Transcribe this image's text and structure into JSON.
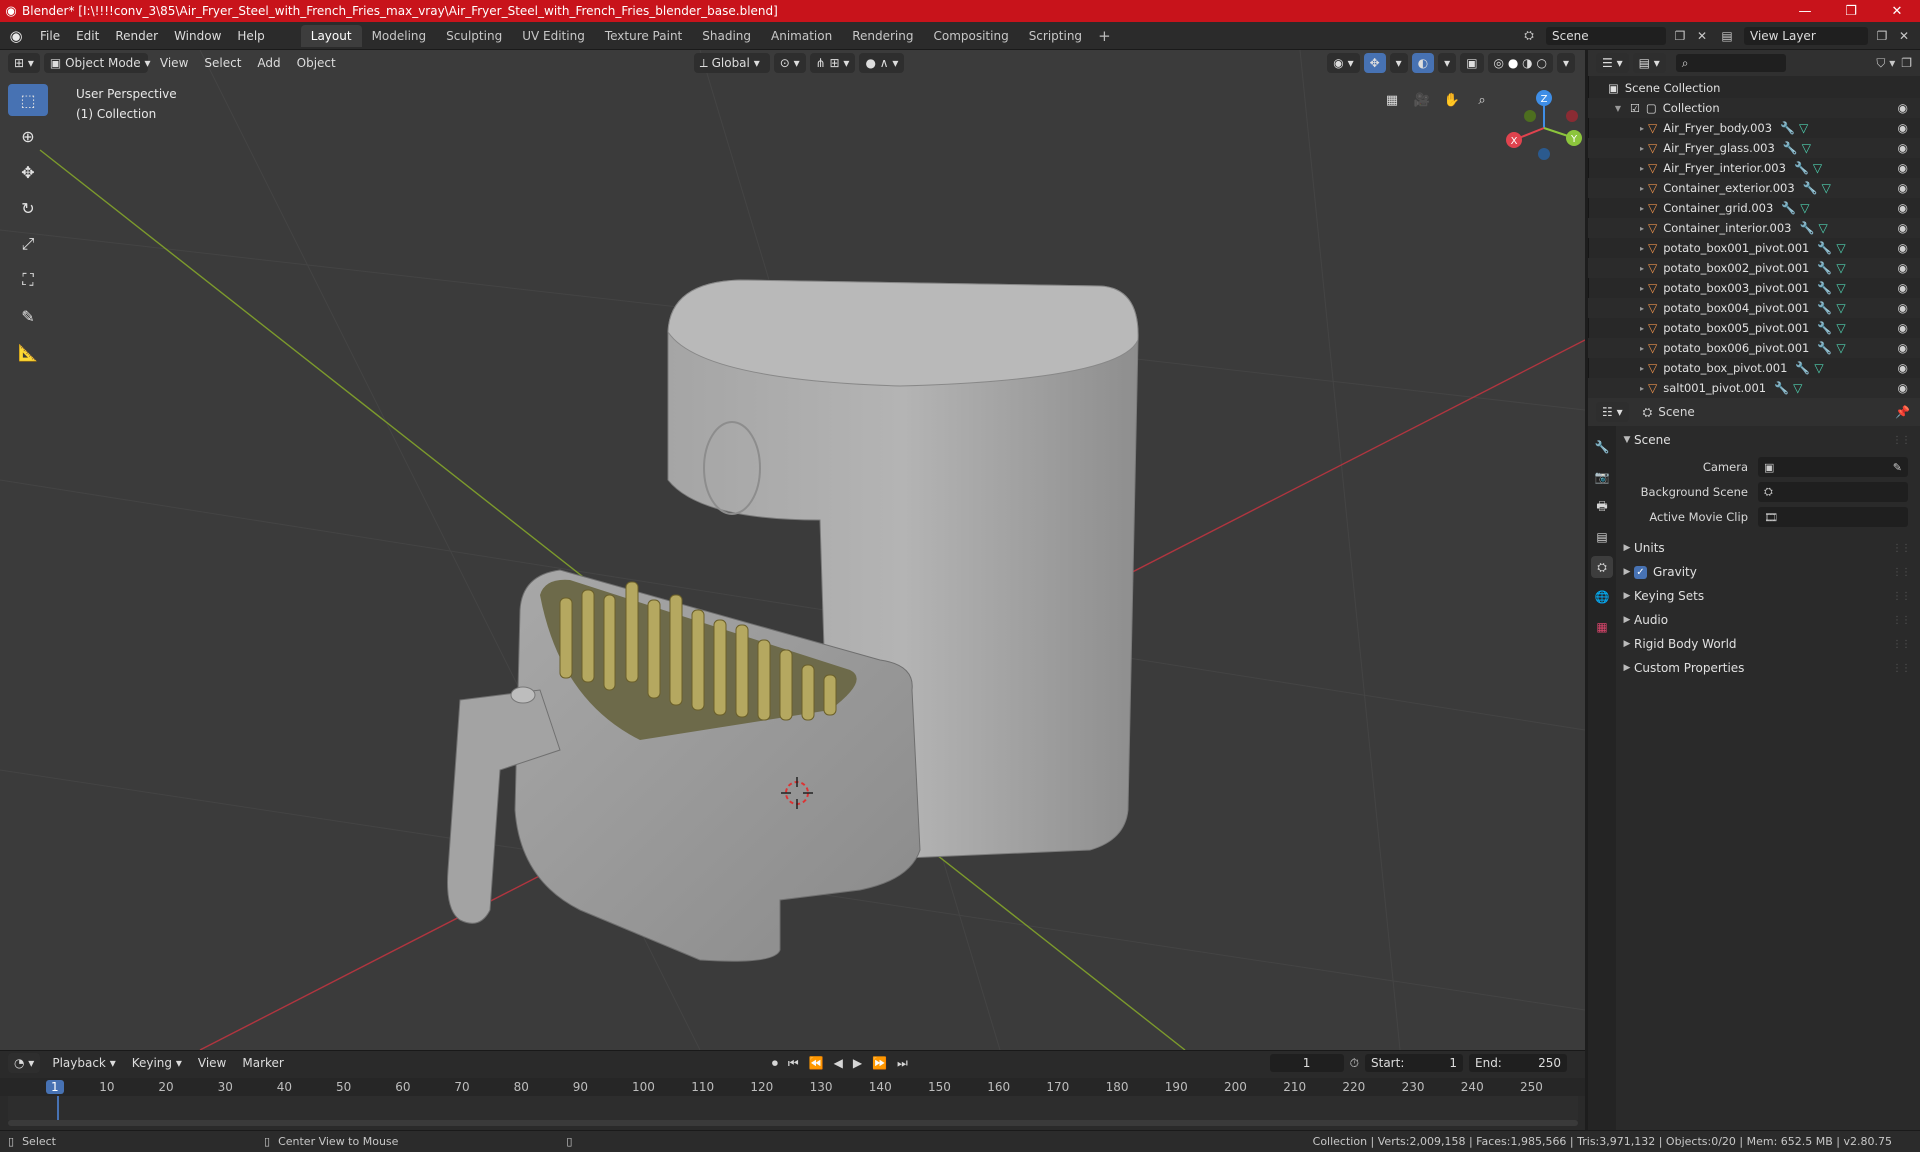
{
  "window": {
    "title": "Blender* [I:\\!!!!conv_3\\85\\Air_Fryer_Steel_with_French_Fries_max_vray\\Air_Fryer_Steel_with_French_Fries_blender_base.blend]",
    "controls": [
      "minimize",
      "maximize",
      "close"
    ]
  },
  "menu": [
    "File",
    "Edit",
    "Render",
    "Window",
    "Help"
  ],
  "workspaces": {
    "tabs": [
      "Layout",
      "Modeling",
      "Sculpting",
      "UV Editing",
      "Texture Paint",
      "Shading",
      "Animation",
      "Rendering",
      "Compositing",
      "Scripting"
    ],
    "active": "Layout"
  },
  "scene_selector": {
    "value": "Scene"
  },
  "view_layer_selector": {
    "value": "View Layer"
  },
  "viewport": {
    "mode": "Object Mode",
    "menus": [
      "View",
      "Select",
      "Add",
      "Object"
    ],
    "transform_orientation": "Global",
    "overlay_text": {
      "perspective": "User Perspective",
      "collection": "(1) Collection"
    },
    "gizmo_axes": [
      "X",
      "Y",
      "Z"
    ]
  },
  "tools": [
    {
      "icon": "select-box-icon",
      "active": true
    },
    {
      "icon": "cursor-icon",
      "active": false
    },
    {
      "icon": "move-icon",
      "active": false
    },
    {
      "icon": "rotate-icon",
      "active": false
    },
    {
      "icon": "scale-icon",
      "active": false
    },
    {
      "icon": "transform-icon",
      "active": false
    },
    {
      "icon": "annotate-icon",
      "active": false
    },
    {
      "icon": "measure-icon",
      "active": false
    }
  ],
  "timeline": {
    "menus": [
      "Playback",
      "Keying",
      "View",
      "Marker"
    ],
    "current_frame": "1",
    "start_label": "Start:",
    "start": "1",
    "end_label": "End:",
    "end": "250",
    "ticks": [
      "1",
      "10",
      "20",
      "30",
      "40",
      "50",
      "60",
      "70",
      "80",
      "90",
      "100",
      "110",
      "120",
      "130",
      "140",
      "150",
      "160",
      "170",
      "180",
      "190",
      "200",
      "210",
      "220",
      "230",
      "240",
      "250"
    ]
  },
  "status": {
    "left": "Select",
    "middle": "Center View to Mouse",
    "right": "Collection | Verts:2,009,158 | Faces:1,985,566 | Tris:3,971,132 | Objects:0/20 | Mem: 652.5 MB | v2.80.75"
  },
  "outliner": {
    "root": "Scene Collection",
    "collection": "Collection",
    "objects": [
      "Air_Fryer_body.003",
      "Air_Fryer_glass.003",
      "Air_Fryer_interior.003",
      "Container_exterior.003",
      "Container_grid.003",
      "Container_interior.003",
      "potato_box001_pivot.001",
      "potato_box002_pivot.001",
      "potato_box003_pivot.001",
      "potato_box004_pivot.001",
      "potato_box005_pivot.001",
      "potato_box006_pivot.001",
      "potato_box_pivot.001",
      "salt001_pivot.001"
    ]
  },
  "properties": {
    "context": "Scene",
    "section": "Scene",
    "fields": [
      {
        "label": "Camera",
        "value": ""
      },
      {
        "label": "Background Scene",
        "value": ""
      },
      {
        "label": "Active Movie Clip",
        "value": ""
      }
    ],
    "subsections": [
      {
        "label": "Units",
        "checkbox": false
      },
      {
        "label": "Gravity",
        "checkbox": true
      },
      {
        "label": "Keying Sets",
        "checkbox": false
      },
      {
        "label": "Audio",
        "checkbox": false
      },
      {
        "label": "Rigid Body World",
        "checkbox": false
      },
      {
        "label": "Custom Properties",
        "checkbox": false
      }
    ]
  },
  "colors": {
    "titlebar": "#c8131b",
    "accent": "#4772b3",
    "viewport_bg": "#3b3b3b",
    "axis_x": "#e0434e",
    "axis_y": "#8cc53c",
    "axis_z": "#3f8ee6",
    "object_icon": "#e9904b",
    "mesh_icon": "#4fd1b0"
  }
}
